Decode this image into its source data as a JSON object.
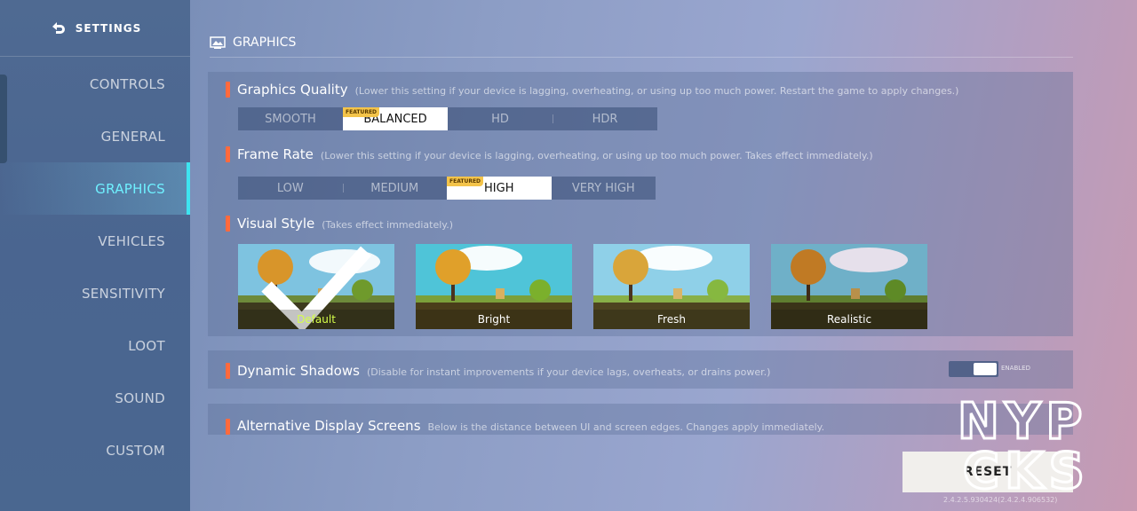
{
  "sidebar": {
    "header": "SETTINGS",
    "items": [
      {
        "label": "CONTROLS",
        "active": false
      },
      {
        "label": "GENERAL",
        "active": false
      },
      {
        "label": "GRAPHICS",
        "active": true
      },
      {
        "label": "VEHICLES",
        "active": false
      },
      {
        "label": "SENSITIVITY",
        "active": false
      },
      {
        "label": "LOOT",
        "active": false
      },
      {
        "label": "SOUND",
        "active": false
      },
      {
        "label": "CUSTOM",
        "active": false
      }
    ]
  },
  "section_title": "GRAPHICS",
  "graphics_quality": {
    "label": "Graphics Quality",
    "desc": "(Lower this setting if your device is lagging, overheating, or using up too much power. Restart the game to apply changes.)",
    "options": [
      "SMOOTH",
      "BALANCED",
      "HD",
      "HDR"
    ],
    "selected": "BALANCED",
    "featured_tag": "FEATURED"
  },
  "frame_rate": {
    "label": "Frame Rate",
    "desc": "(Lower this setting if your device is lagging, overheating, or using up too much power. Takes effect immediately.)",
    "options": [
      "LOW",
      "MEDIUM",
      "HIGH",
      "VERY HIGH"
    ],
    "selected": "HIGH",
    "featured_tag": "FEATURED"
  },
  "visual_style": {
    "label": "Visual Style",
    "desc": "(Takes effect immediately.)",
    "options": [
      "Default",
      "Bright",
      "Fresh",
      "Realistic"
    ],
    "selected": "Default"
  },
  "dynamic_shadows": {
    "label": "Dynamic Shadows",
    "desc": "(Disable for instant improvements if your device lags, overheats, or drains power.)",
    "state": "ENABLED"
  },
  "alt_display": {
    "label": "Alternative Display Screens",
    "desc": "Below is the distance between UI and screen edges. Changes apply immediately."
  },
  "reset_label": "RESET",
  "version": "2.4.2.5.930424(2.4.2.4.906532)",
  "watermark": {
    "line1": "NYP",
    "line2": "CKS"
  },
  "colors": {
    "accent": "#3ee4f0",
    "marker": "#ff6a3d",
    "selected_style": "#d6ff4a",
    "featured": "#f4c44a"
  }
}
